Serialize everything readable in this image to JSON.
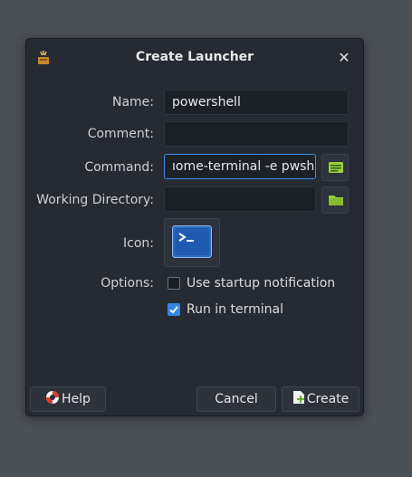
{
  "dialog": {
    "title": "Create Launcher",
    "app_icon": "launcher-app-icon",
    "close_icon": "close-icon"
  },
  "form": {
    "name_label": "Name:",
    "name_value": "powershell",
    "comment_label": "Comment:",
    "comment_value": "",
    "command_label": "Command:",
    "command_value": "ıome-terminal -e pwsh",
    "working_dir_label": "Working Directory:",
    "working_dir_value": "",
    "icon_label": "Icon:",
    "icon_name": "powershell-terminal-icon",
    "options_label": "Options:",
    "option_startup_label": "Use startup notification",
    "option_startup_checked": false,
    "option_terminal_label": "Run in terminal",
    "option_terminal_checked": true
  },
  "buttons": {
    "help_label": "Help",
    "cancel_label": "Cancel",
    "create_label": "Create"
  },
  "colors": {
    "accent": "#3584e4",
    "folder_green": "#9bd140",
    "terminal_blue": "#2a6dc9"
  }
}
